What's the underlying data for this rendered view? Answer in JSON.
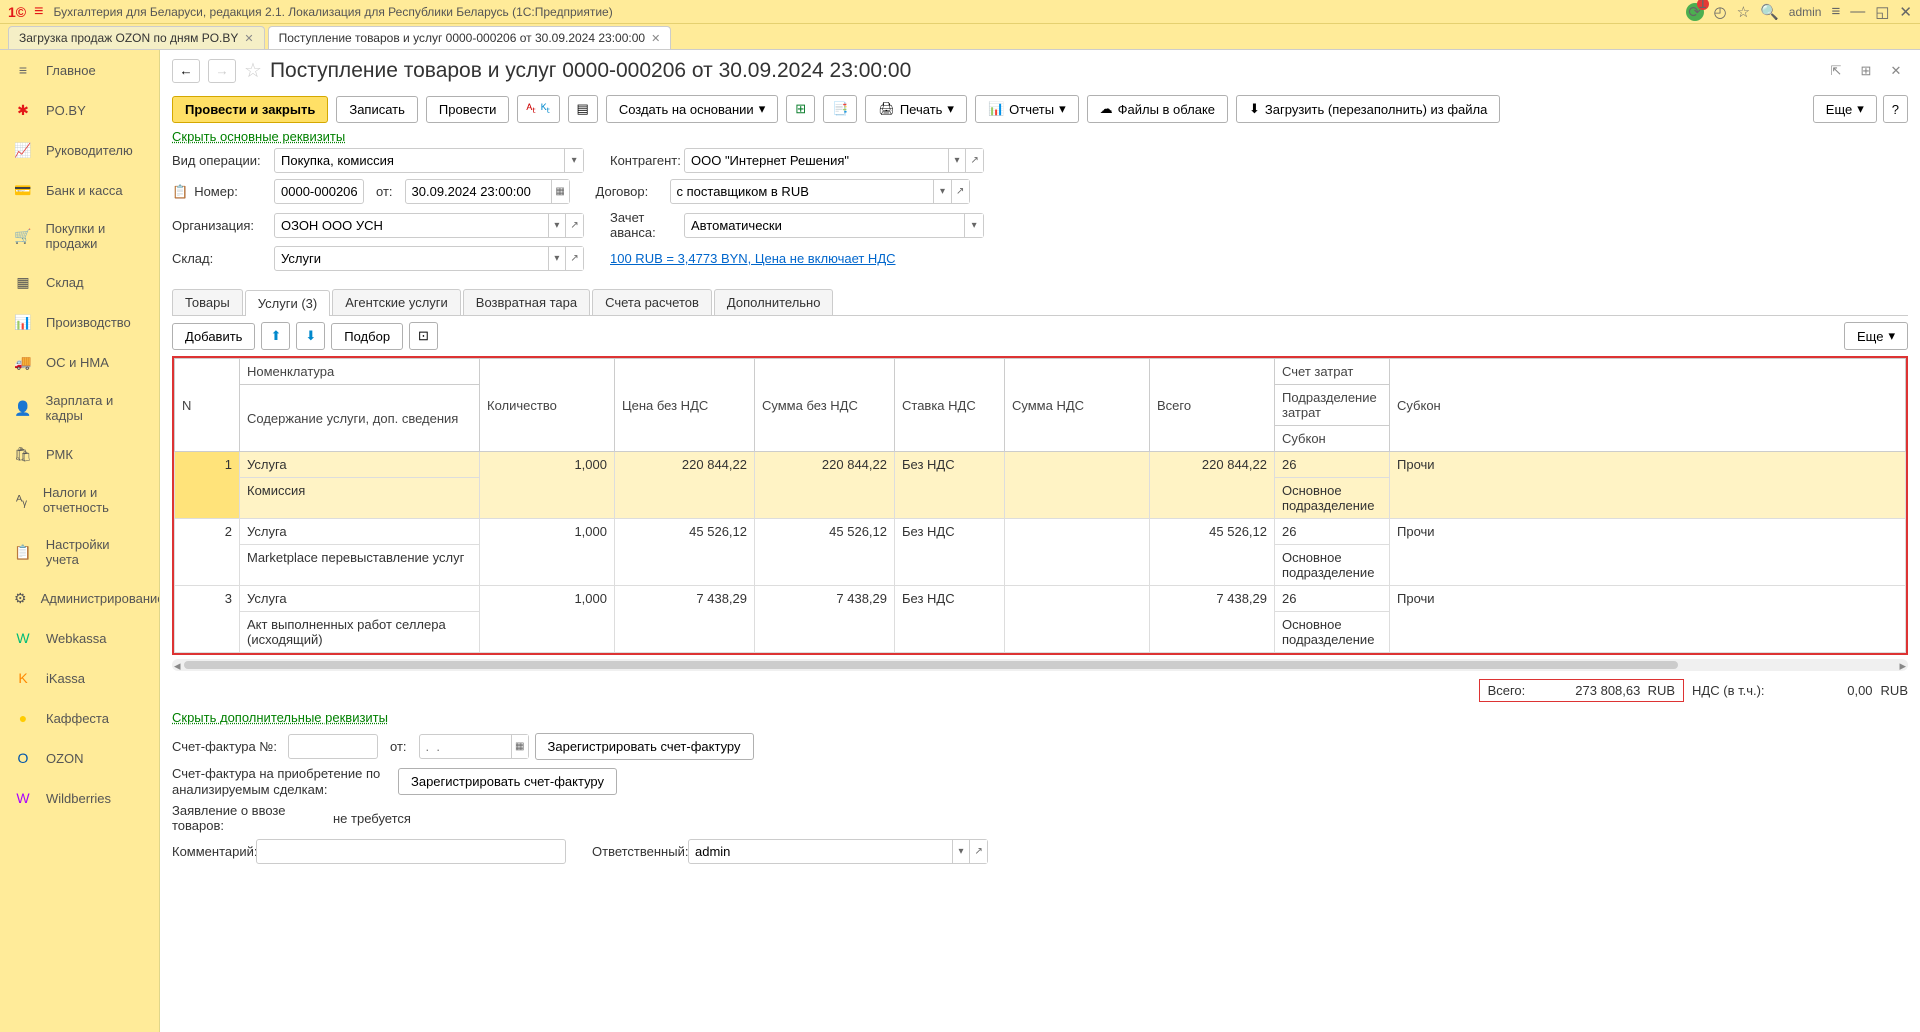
{
  "titlebar": {
    "app_name": "Бухгалтерия для Беларуси, редакция 2.1. Локализация для Республики Беларусь  (1С:Предприятие)",
    "user": "admin",
    "alert_count": "1"
  },
  "tabs": [
    {
      "label": "Загрузка продаж OZON по дням PO.BY"
    },
    {
      "label": "Поступление товаров и услуг 0000-000206 от 30.09.2024 23:00:00"
    }
  ],
  "sidebar": [
    {
      "label": "Главное"
    },
    {
      "label": "PO.BY"
    },
    {
      "label": "Руководителю"
    },
    {
      "label": "Банк и касса"
    },
    {
      "label": "Покупки и продажи"
    },
    {
      "label": "Склад"
    },
    {
      "label": "Производство"
    },
    {
      "label": "ОС и НМА"
    },
    {
      "label": "Зарплата и кадры"
    },
    {
      "label": "РМК"
    },
    {
      "label": "Налоги и отчетность"
    },
    {
      "label": "Настройки учета"
    },
    {
      "label": "Администрирование"
    },
    {
      "label": "Webkassa"
    },
    {
      "label": "iKassa"
    },
    {
      "label": "Каффеста"
    },
    {
      "label": "OZON"
    },
    {
      "label": "Wildberries"
    }
  ],
  "side_icons": [
    "≡",
    "✱",
    "📈",
    "💳",
    "🛒",
    "▦",
    "📊",
    "🚚",
    "👤",
    "🛍",
    "ᴬᵧ",
    "📋",
    "⚙",
    "W",
    "K",
    "●",
    "O",
    "W"
  ],
  "side_icon_colors": [
    "#666",
    "#e31818",
    "#555",
    "#555",
    "#555",
    "#555",
    "#555",
    "#555",
    "#555",
    "#555",
    "#555",
    "#555",
    "#555",
    "#0b7",
    "#f80",
    "#fc0",
    "#05a",
    "#a0f"
  ],
  "doc": {
    "title": "Поступление товаров и услуг 0000-000206 от 30.09.2024 23:00:00",
    "hide_req": "Скрыть основные реквизиты",
    "hide_add": "Скрыть дополнительные реквизиты"
  },
  "toolbar": {
    "post_close": "Провести и закрыть",
    "write": "Записать",
    "post": "Провести",
    "create_based": "Создать на основании",
    "print": "Печать",
    "reports": "Отчеты",
    "files": "Файлы в облаке",
    "load": "Загрузить (перезаполнить) из файла",
    "more": "Еще"
  },
  "form": {
    "op_type_lbl": "Вид операции:",
    "op_type": "Покупка, комиссия",
    "number_lbl": "Номер:",
    "number": "0000-000206",
    "date_lbl": "от:",
    "date": "30.09.2024 23:00:00",
    "org_lbl": "Организация:",
    "org": "ОЗОН ООО УСН",
    "wh_lbl": "Склад:",
    "wh": "Услуги",
    "counter_lbl": "Контрагент:",
    "counter": "ООО \"Интернет Решения\"",
    "contract_lbl": "Договор:",
    "contract": "с поставщиком в RUB",
    "advance_lbl": "Зачет аванса:",
    "advance": "Автоматически",
    "rate_link": "100 RUB = 3,4773 BYN, Цена не включает НДС"
  },
  "doc_tabs": [
    "Товары",
    "Услуги (3)",
    "Агентские услуги",
    "Возвратная тара",
    "Счета расчетов",
    "Дополнительно"
  ],
  "tbl_toolbar": {
    "add": "Добавить",
    "pick": "Подбор",
    "more": "Еще"
  },
  "headers": {
    "n": "N",
    "nom": "Номенклатура",
    "desc": "Содержание услуги, доп. сведения",
    "qty": "Количество",
    "price": "Цена без НДС",
    "sum": "Сумма без НДС",
    "vat": "Ставка НДС",
    "vat_sum": "Сумма НДС",
    "total": "Всего",
    "acc": "Счет затрат",
    "dep": "Подразделение затрат",
    "sub": "Субкон"
  },
  "rows": [
    {
      "n": "1",
      "nom": "Услуга",
      "desc": "Комиссия",
      "qty": "1,000",
      "price": "220 844,22",
      "sum": "220 844,22",
      "vat": "Без НДС",
      "vat_sum": "",
      "total": "220 844,22",
      "acc": "26",
      "dep": "Основное подразделение",
      "sub": "Прочи"
    },
    {
      "n": "2",
      "nom": "Услуга",
      "desc": "Marketplace перевыставление услуг",
      "qty": "1,000",
      "price": "45 526,12",
      "sum": "45 526,12",
      "vat": "Без НДС",
      "vat_sum": "",
      "total": "45 526,12",
      "acc": "26",
      "dep": "Основное подразделение",
      "sub": "Прочи"
    },
    {
      "n": "3",
      "nom": "Услуга",
      "desc": "Акт выполненных работ селлера (исходящий)",
      "qty": "1,000",
      "price": "7 438,29",
      "sum": "7 438,29",
      "vat": "Без НДС",
      "vat_sum": "",
      "total": "7 438,29",
      "acc": "26",
      "dep": "Основное подразделение",
      "sub": "Прочи"
    }
  ],
  "totals": {
    "label": "Всего:",
    "value": "273 808,63",
    "cur": "RUB",
    "vat_label": "НДС (в т.ч.):",
    "vat_value": "0,00",
    "vat_cur": "RUB"
  },
  "footer": {
    "sf_num": "Счет-фактура №:",
    "from": "от:",
    "date_ph": ".  .",
    "reg_sf": "Зарегистрировать счет-фактуру",
    "sf_acq": "Счет-фактура на приобретение по анализируемым сделкам:",
    "decl": "Заявление о ввозе товаров:",
    "decl_val": "не требуется",
    "comment_lbl": "Комментарий:",
    "comment": "",
    "resp_lbl": "Ответственный:",
    "resp": "admin"
  }
}
